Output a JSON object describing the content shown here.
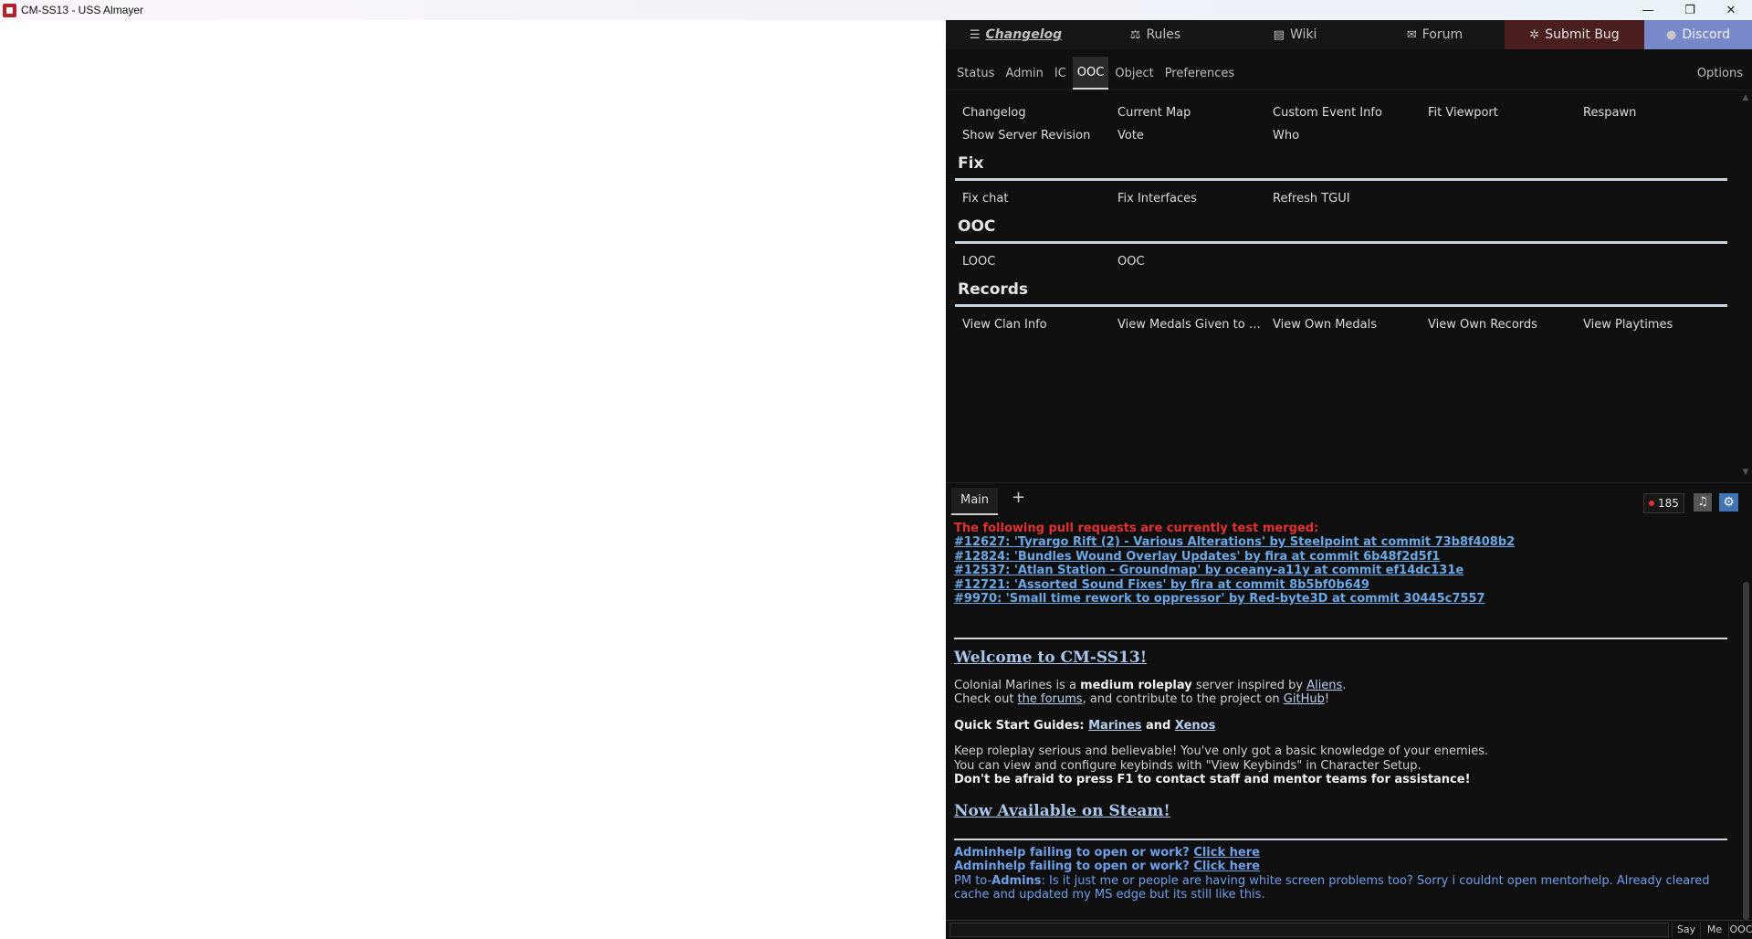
{
  "window": {
    "title": "CM-SS13 - USS Almayer",
    "minimize": "—",
    "maximize": "❐",
    "close": "✕"
  },
  "linkbar": {
    "changelog": "Changelog",
    "rules": "Rules",
    "wiki": "Wiki",
    "forum": "Forum",
    "submit_bug": "Submit Bug",
    "discord": "Discord",
    "icons": {
      "changelog": "list-icon",
      "rules": "scale-icon",
      "wiki": "book-icon",
      "forum": "envelope-icon",
      "submit_bug": "bug-icon",
      "discord": "chat-bubbles-icon"
    },
    "colors": {
      "submit_bug_bg": "#4a1d1f",
      "discord_bg": "#7889c9"
    }
  },
  "stat_tabs": {
    "items": [
      "Status",
      "Admin",
      "IC",
      "OOC",
      "Object",
      "Preferences"
    ],
    "active": "OOC",
    "options": "Options"
  },
  "verbs": {
    "general": [
      "Changelog",
      "Current Map",
      "Custom Event Info",
      "Fit Viewport",
      "Respawn",
      "Show Server Revision",
      "Vote",
      "Who"
    ],
    "sections": [
      {
        "title": "Fix",
        "items": [
          "Fix chat",
          "Fix Interfaces",
          "Refresh TGUI"
        ]
      },
      {
        "title": "OOC",
        "items": [
          "LOOC",
          "OOC"
        ]
      },
      {
        "title": "Records",
        "items": [
          "View Clan Info",
          "View Medals Given to O...",
          "View Own Medals",
          "View Own Records",
          "View Playtimes"
        ]
      }
    ]
  },
  "chat": {
    "tabs": [
      "Main"
    ],
    "add": "+",
    "ping": "185",
    "music_icon": "music-note-icon",
    "settings_icon": "gear-icon",
    "test_merge_header": "The following pull requests are currently test merged:",
    "test_merges": [
      "#12627: 'Tyrargo Rift (2) - Various Alterations' by Steelpoint at commit 73b8f408b2",
      "#12824: 'Bundles Wound Overlay Updates' by fira at commit 6b48f2d5f1",
      "#12537: 'Atlan Station - Groundmap' by oceany-a11y at commit ef14dc131e",
      "#12721: 'Assorted Sound Fixes' by fira at commit 8b5bf0b649",
      "#9970: 'Small time rework to oppressor' by Red-byte3D at commit 30445c7557"
    ],
    "welcome_title": "Welcome to CM-SS13!",
    "intro": {
      "p1a": "Colonial Marines is a ",
      "p1b": "medium roleplay",
      "p1c": " server inspired by ",
      "p1d": "Aliens",
      "p1e": ".",
      "p2a": "Check out ",
      "p2b": "the forums",
      "p2c": ", and contribute to the project on ",
      "p2d": "GitHub",
      "p2e": "!"
    },
    "quick_start": {
      "label": "Quick Start Guides: ",
      "marines": "Marines",
      "and": " and ",
      "xenos": "Xenos"
    },
    "tips": [
      "Keep roleplay serious and believable! You've only got a basic knowledge of your enemies.",
      "You can view and configure keybinds with \"View Keybinds\" in Character Setup."
    ],
    "tip_bold": "Don't be afraid to press F1 to contact staff and mentor teams for assistance!",
    "steam_title": "Now Available on Steam!",
    "adminhelp_text": "Adminhelp failing to open or work? ",
    "adminhelp_link": "Click here",
    "pm_prefix": "PM to-",
    "pm_target": "Admins",
    "pm_message": ": Is it just me or people are having white screen problems too? Sorry i couldnt open mentorhelp.  Already cleared cache and updated my MS edge but its still like this."
  },
  "input": {
    "say": "Say",
    "me": "Me",
    "ooc": "OOC"
  }
}
